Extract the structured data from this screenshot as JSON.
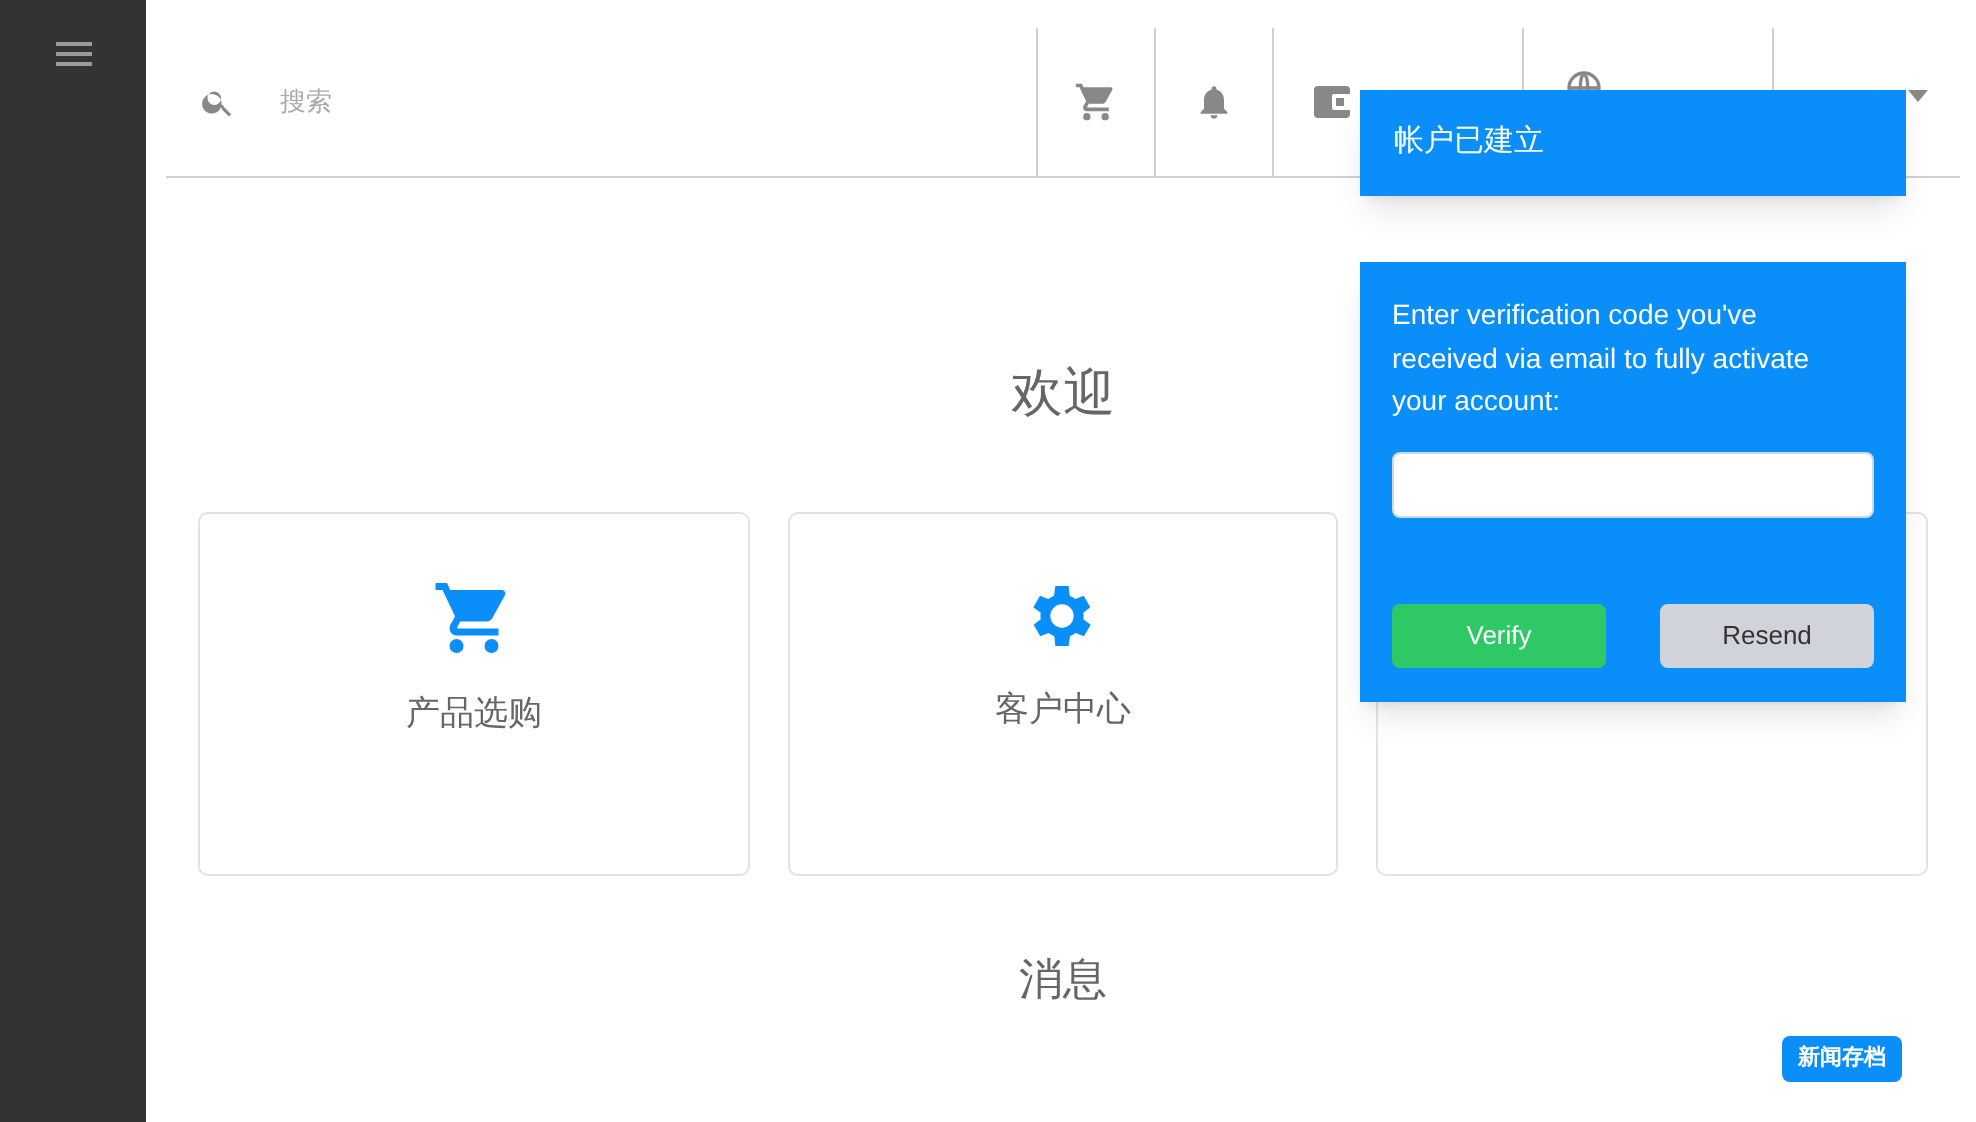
{
  "search": {
    "placeholder": "搜索"
  },
  "heading": "欢迎",
  "cards": [
    {
      "kind": "cart",
      "label": "产品选购"
    },
    {
      "kind": "gear",
      "label": "客户中心"
    },
    {
      "kind": "hidden"
    }
  ],
  "messages_heading": "消息",
  "news_badge": "新闻存档",
  "toast": {
    "title": "帐户已建立"
  },
  "verify_dialog": {
    "message": "Enter verification code you've received via email to fully activate your account:",
    "buttons": [
      {
        "kind": "primary",
        "label": "Verify"
      },
      {
        "kind": "secondary",
        "label": "Resend"
      }
    ]
  }
}
